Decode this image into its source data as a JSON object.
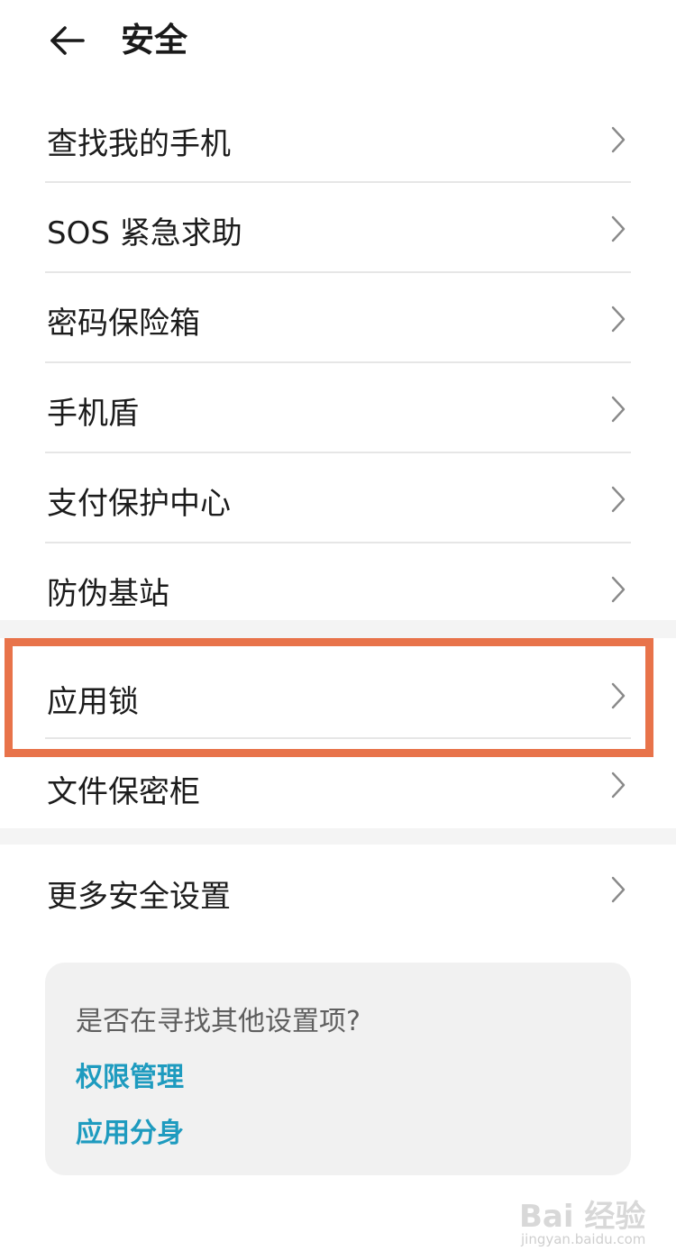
{
  "header": {
    "title": "安全"
  },
  "menu": {
    "items": [
      {
        "label": "查找我的手机"
      },
      {
        "label": "SOS 紧急求助"
      },
      {
        "label": "密码保险箱"
      },
      {
        "label": "手机盾"
      },
      {
        "label": "支付保护中心"
      },
      {
        "label": "防伪基站"
      },
      {
        "label": "应用锁"
      },
      {
        "label": "文件保密柜"
      },
      {
        "label": "更多安全设置"
      }
    ]
  },
  "suggestions": {
    "hint": "是否在寻找其他设置项?",
    "links": [
      {
        "label": "权限管理"
      },
      {
        "label": "应用分身"
      }
    ]
  },
  "watermark": {
    "text": "Bai 经验",
    "sub": "jingyan.baidu.com"
  },
  "colors": {
    "highlight_border": "#e8734a",
    "link": "#1e9bbf",
    "card_bg": "#f1f1f1",
    "divider": "#e6e6e6"
  },
  "icons": {
    "back": "arrow-left-icon",
    "chevron": "chevron-right-icon"
  }
}
